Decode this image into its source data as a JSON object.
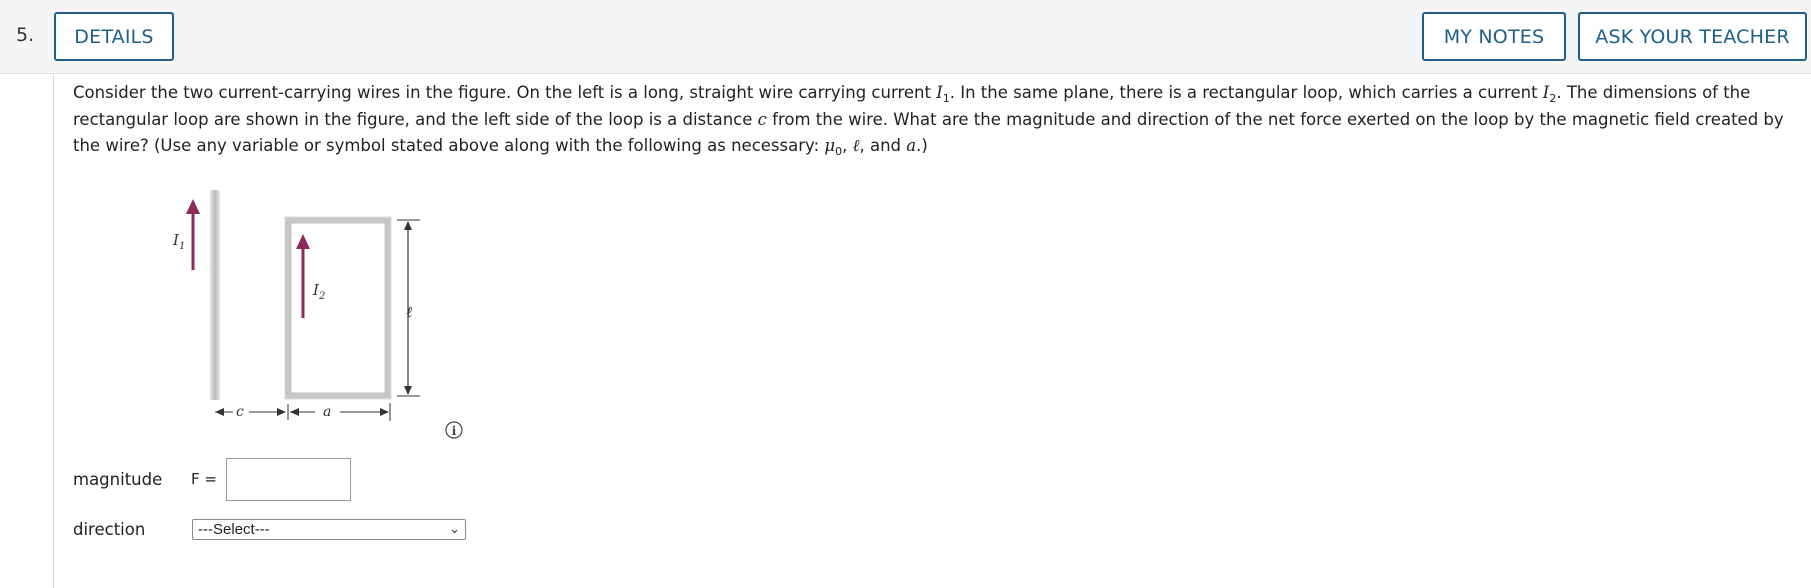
{
  "question": {
    "number": "5.",
    "buttons": {
      "details": "DETAILS",
      "my_notes": "MY NOTES",
      "ask_teacher": "ASK YOUR TEACHER"
    },
    "prompt": {
      "p1": "Consider the two current-carrying wires in the figure. On the left is a long, straight wire carrying current ",
      "i1_sym": "I",
      "i1_sub": "1",
      "p2": ". In the same plane, there is a rectangular loop, which carries a current ",
      "i2_sym": "I",
      "i2_sub": "2",
      "p3": ". The dimensions of the rectangular loop are shown in the figure, and the left side of the loop is a distance ",
      "c_sym": "c",
      "p4": " from the wire. What are the magnitude and direction of the net force exerted on the loop by the magnetic field created by the wire? (Use any variable or symbol stated above along with the following as necessary: ",
      "mu_sym": "μ",
      "mu_sub": "0",
      "p5": ", ",
      "ell_sym": "ℓ",
      "p6": ", and ",
      "a_sym": "a",
      "p7": ".)"
    },
    "figure": {
      "wire_current_label": "I",
      "wire_current_sub": "1",
      "loop_current_label": "I",
      "loop_current_sub": "2",
      "length_label": "ℓ",
      "c_label": "c",
      "a_label": "a",
      "info_symbol": "i",
      "colors": {
        "arrow": "#8b2a5e",
        "wire": "#cfcfcf",
        "loop": "#c4c4c4"
      }
    },
    "magnitude": {
      "label": "magnitude",
      "equation_prefix": "F =",
      "value": ""
    },
    "direction": {
      "label": "direction",
      "selected": "---Select---"
    },
    "accent_color": "#1d5f8a"
  }
}
